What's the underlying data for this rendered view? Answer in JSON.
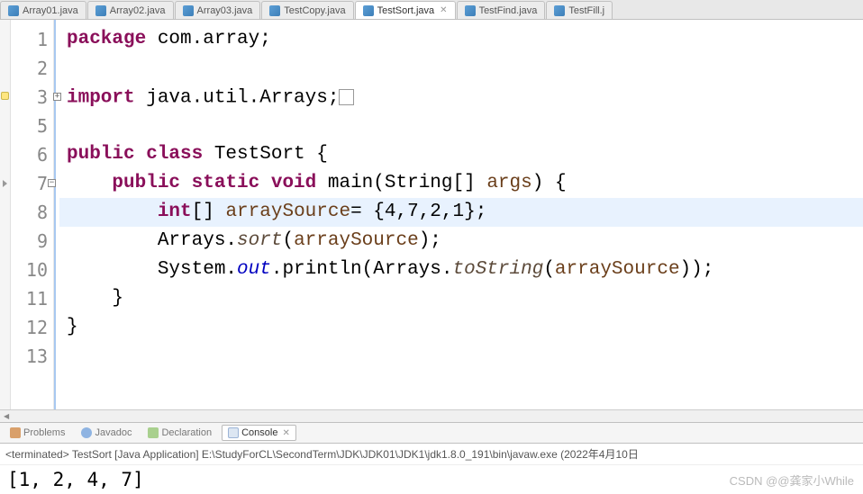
{
  "tabs": [
    {
      "label": "Array01.java",
      "active": false
    },
    {
      "label": "Array02.java",
      "active": false
    },
    {
      "label": "Array03.java",
      "active": false
    },
    {
      "label": "TestCopy.java",
      "active": false
    },
    {
      "label": "TestSort.java",
      "active": true
    },
    {
      "label": "TestFind.java",
      "active": false
    },
    {
      "label": "TestFill.j",
      "active": false
    }
  ],
  "code": {
    "lines": [
      {
        "n": "1",
        "tokens": [
          {
            "t": "package ",
            "c": "kw"
          },
          {
            "t": "com.array;",
            "c": "plain"
          }
        ]
      },
      {
        "n": "2",
        "tokens": []
      },
      {
        "n": "3",
        "fold": "plus",
        "marker": "yellow",
        "tokens": [
          {
            "t": "import ",
            "c": "kw"
          },
          {
            "t": "java.util.Arrays;",
            "c": "plain"
          },
          {
            "t": " ",
            "c": "box-end"
          }
        ]
      },
      {
        "n": "5",
        "tokens": []
      },
      {
        "n": "6",
        "tokens": [
          {
            "t": "public class ",
            "c": "kw"
          },
          {
            "t": "TestSort {",
            "c": "plain"
          }
        ]
      },
      {
        "n": "7",
        "fold": "minus",
        "marker": "arrow",
        "tokens": [
          {
            "t": "    ",
            "c": "plain"
          },
          {
            "t": "public static void ",
            "c": "kw"
          },
          {
            "t": "main(String[] ",
            "c": "plain"
          },
          {
            "t": "args",
            "c": "param"
          },
          {
            "t": ") {",
            "c": "plain"
          }
        ]
      },
      {
        "n": "8",
        "hl": true,
        "tokens": [
          {
            "t": "        ",
            "c": "plain"
          },
          {
            "t": "int",
            "c": "kw"
          },
          {
            "t": "[] ",
            "c": "plain"
          },
          {
            "t": "arraySource",
            "c": "param"
          },
          {
            "t": "= {4,7,2,1};",
            "c": "plain"
          }
        ]
      },
      {
        "n": "9",
        "tokens": [
          {
            "t": "        Arrays.",
            "c": "plain"
          },
          {
            "t": "sort",
            "c": "var-it"
          },
          {
            "t": "(",
            "c": "plain"
          },
          {
            "t": "arraySource",
            "c": "param"
          },
          {
            "t": ");",
            "c": "plain"
          }
        ]
      },
      {
        "n": "10",
        "tokens": [
          {
            "t": "        System.",
            "c": "plain"
          },
          {
            "t": "out",
            "c": "static-it"
          },
          {
            "t": ".println(Arrays.",
            "c": "plain"
          },
          {
            "t": "toString",
            "c": "var-it"
          },
          {
            "t": "(",
            "c": "plain"
          },
          {
            "t": "arraySource",
            "c": "param"
          },
          {
            "t": "));",
            "c": "plain"
          }
        ]
      },
      {
        "n": "11",
        "tokens": [
          {
            "t": "    }",
            "c": "plain"
          }
        ]
      },
      {
        "n": "12",
        "tokens": [
          {
            "t": "}",
            "c": "plain"
          }
        ]
      },
      {
        "n": "13",
        "tokens": []
      }
    ]
  },
  "bottom_tabs": {
    "problems": "Problems",
    "javadoc": "Javadoc",
    "declaration": "Declaration",
    "console": "Console"
  },
  "console": {
    "status": "<terminated> TestSort [Java Application] E:\\StudyForCL\\SecondTerm\\JDK\\JDK01\\JDK1\\jdk1.8.0_191\\bin\\javaw.exe (2022年4月10日",
    "output": "[1, 2, 4, 7]"
  },
  "watermark": "CSDN @@龚家小While"
}
